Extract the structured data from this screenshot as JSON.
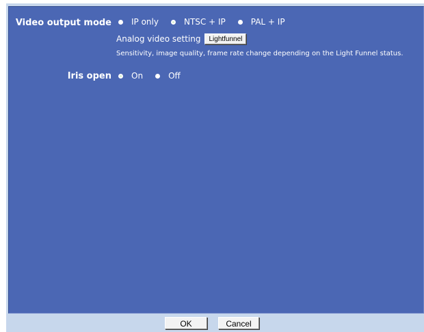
{
  "video_output_mode": {
    "label": "Video output mode",
    "options": [
      "IP only",
      "NTSC + IP",
      "PAL + IP"
    ],
    "selected": "NTSC + IP"
  },
  "analog": {
    "label": "Analog video setting",
    "button_label": "Lightfunnel",
    "note": "Sensitivity, image quality, frame rate change depending on the Light Funnel status."
  },
  "iris_open": {
    "label": "Iris open",
    "options": [
      "On",
      "Off"
    ],
    "selected": "On"
  },
  "footer": {
    "ok_label": "OK",
    "cancel_label": "Cancel"
  },
  "colors": {
    "panel_bg": "#4b67b4",
    "outer_bg": "#c7d7ec"
  }
}
